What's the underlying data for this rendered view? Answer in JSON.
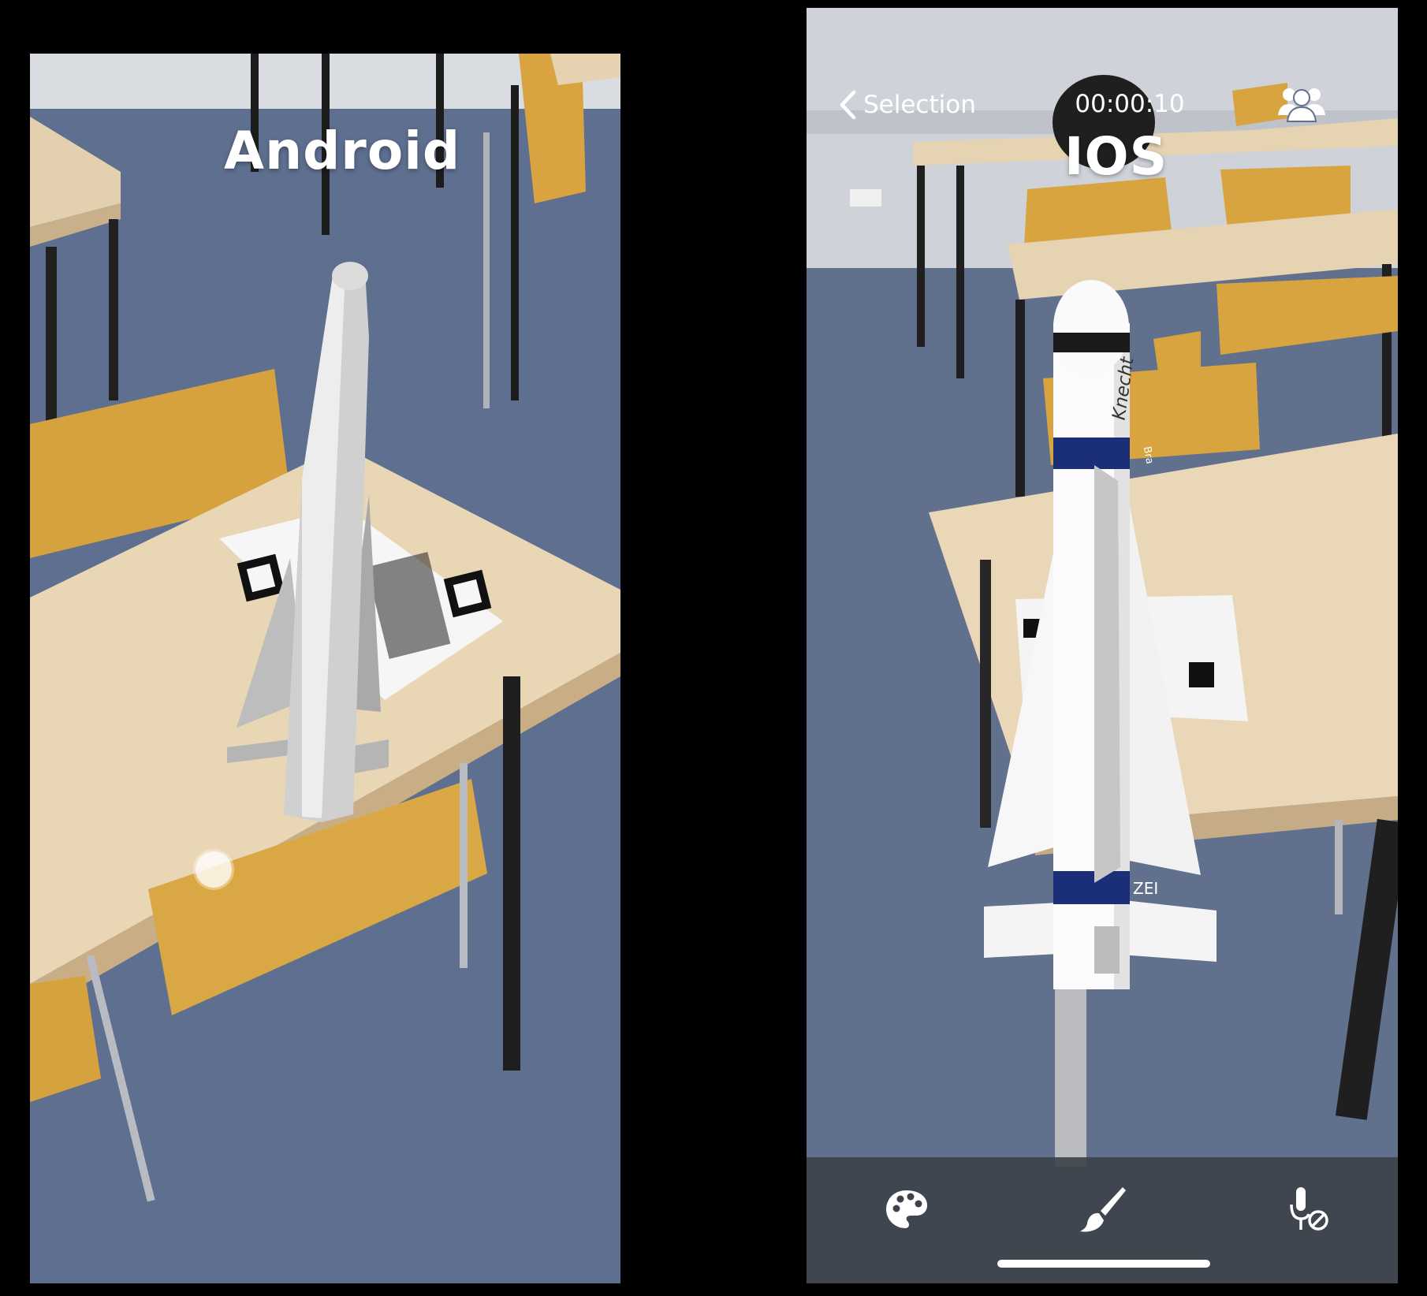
{
  "android": {
    "label": "Android"
  },
  "ios": {
    "label": "IOS",
    "nav": {
      "back_label": "Selection",
      "timer": "00:00:10"
    },
    "model": {
      "brand_text": "Knecht",
      "band_text_top": "Bra",
      "band_text_bottom": "ZEI"
    },
    "toolbar": {
      "icons": [
        "palette-icon",
        "brush-icon",
        "microphone-muted-icon"
      ]
    }
  },
  "colors": {
    "navy_band": "#1b2f78",
    "floor": "#5d6d8d",
    "desk": "#e6d2b0",
    "chair": "#d8a640"
  }
}
